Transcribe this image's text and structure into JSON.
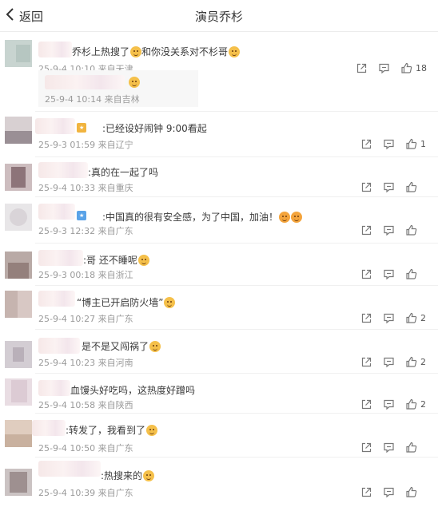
{
  "header": {
    "back_label": "返回",
    "title": "演员乔杉"
  },
  "comments": [
    {
      "text": "乔杉上热搜了",
      "text2": "和你没关系对不杉哥",
      "meta": "25-9-4 10:10 来自天津",
      "likes": "18",
      "reply": {
        "text": "",
        "meta": "25-9-4 10:14 来自吉林"
      }
    },
    {
      "text": ":已经设好闹钟 9:00看起",
      "meta": "25-9-3 01:59 来自辽宁",
      "likes": "1"
    },
    {
      "text": ":真的在一起了吗",
      "meta": "25-9-4 10:33 来自重庆",
      "likes": ""
    },
    {
      "text": ":中国真的很有安全感，为了中国，加油！",
      "meta": "25-9-3 12:32 来自广东",
      "likes": ""
    },
    {
      "text": ":哥 还不睡呢",
      "meta": "25-9-3 00:18 来自浙江",
      "likes": ""
    },
    {
      "text": "“博主已开启防火墙”",
      "meta": "25-9-4 10:27 来自广东",
      "likes": "2"
    },
    {
      "text": "是不是又闯祸了",
      "meta": "25-9-4 10:23 来自河南",
      "likes": "2"
    },
    {
      "text": "血馒头好吃吗，这热度好蹭吗",
      "meta": "25-9-4 10:58 来自陕西",
      "likes": "2"
    },
    {
      "text": ":转发了，我看到了",
      "meta": "25-9-4 10:50 来自广东",
      "likes": ""
    },
    {
      "text": ":热搜来的",
      "meta": "25-9-4 10:39 来自广东",
      "likes": ""
    }
  ]
}
